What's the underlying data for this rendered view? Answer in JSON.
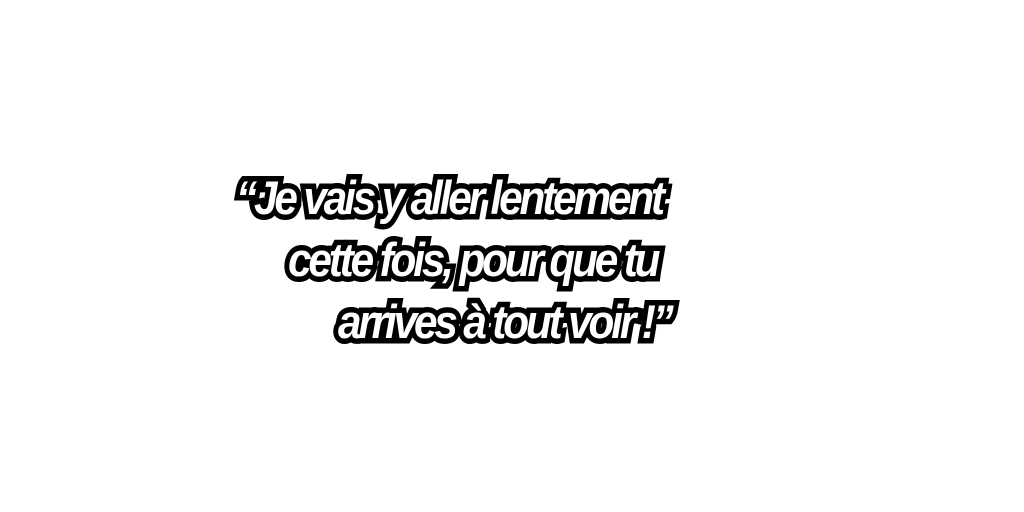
{
  "quote": {
    "lines": [
      "“Je vais y aller lentement",
      "cette fois, pour que tu",
      "arrives à tout voir !”"
    ]
  },
  "colors": {
    "background": "#ffffff",
    "text_fill": "#ffffff",
    "text_outline": "#000000"
  }
}
